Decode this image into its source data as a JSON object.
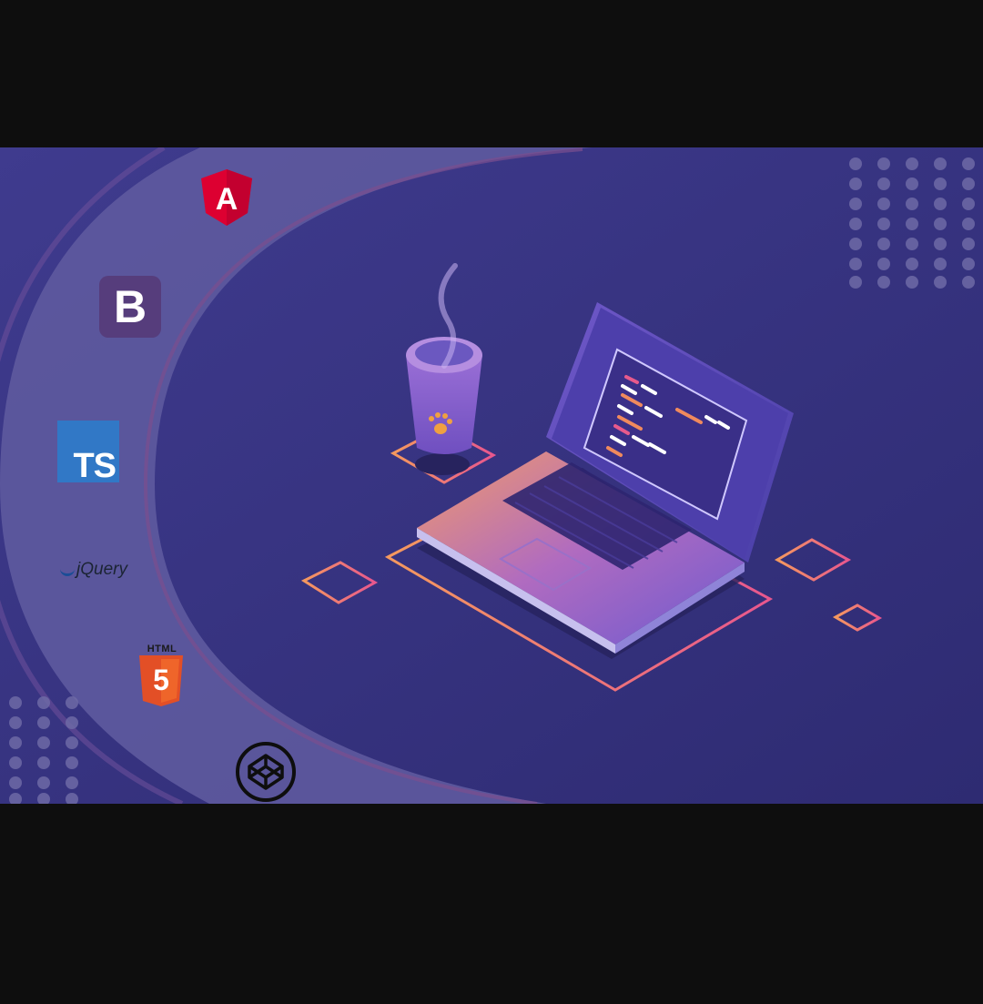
{
  "scene": {
    "description_free": true,
    "colors": {
      "background_letterbox": "#0e0e0e",
      "banner_base": "#3d3a8a",
      "arc_band": "#5e5a9e",
      "accent_orange": "#f08a5d",
      "accent_pink": "#e85a8c",
      "screen": "#3a3280"
    }
  },
  "logos": {
    "angular": {
      "icon": "angular-logo-icon",
      "letter": "A"
    },
    "bootstrap": {
      "icon": "bootstrap-logo-icon",
      "letter": "B"
    },
    "typescript": {
      "icon": "typescript-logo-icon",
      "text": "TS"
    },
    "jquery": {
      "icon": "jquery-logo-icon",
      "text": "jQuery"
    },
    "html5": {
      "icon": "html5-logo-icon",
      "label": "HTML",
      "number": "5"
    },
    "codepen": {
      "icon": "codepen-logo-icon"
    }
  },
  "illustration": {
    "laptop_icon": "laptop-icon",
    "cup_icon": "coffee-cup-icon",
    "paw_icon": "paw-print-icon"
  }
}
